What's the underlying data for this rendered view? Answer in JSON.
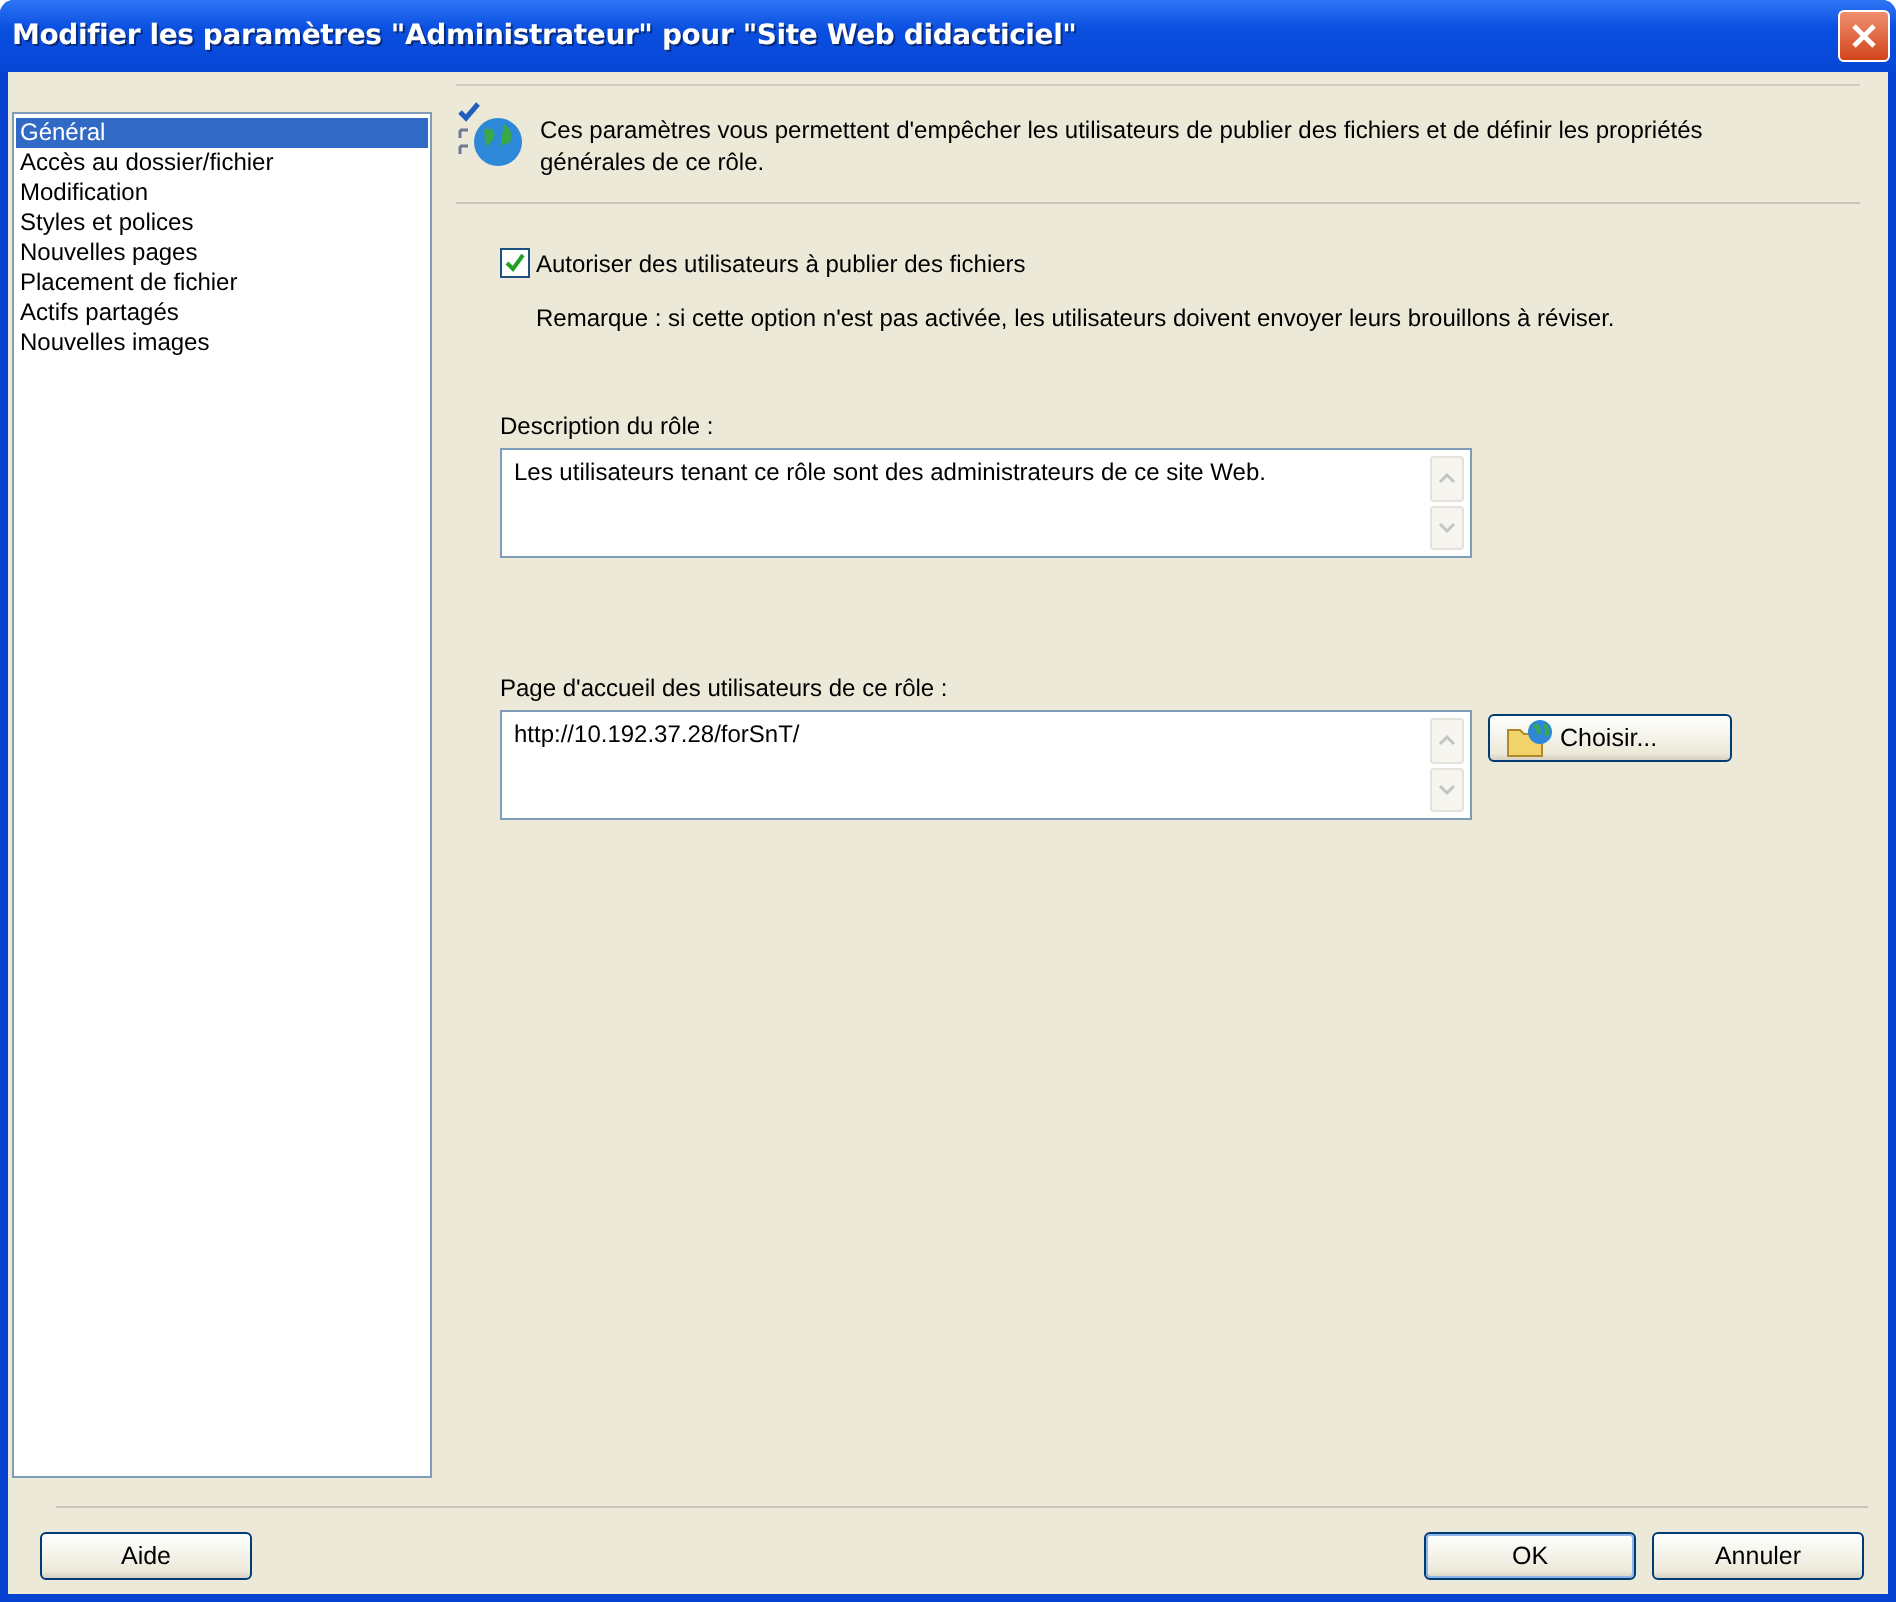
{
  "window": {
    "title": "Modifier les paramètres \"Administrateur\" pour \"Site Web didacticiel\""
  },
  "sidebar": {
    "items": [
      {
        "label": "Général",
        "selected": true
      },
      {
        "label": "Accès au dossier/fichier",
        "selected": false
      },
      {
        "label": "Modification",
        "selected": false
      },
      {
        "label": "Styles et polices",
        "selected": false
      },
      {
        "label": "Nouvelles pages",
        "selected": false
      },
      {
        "label": "Placement de fichier",
        "selected": false
      },
      {
        "label": "Actifs partagés",
        "selected": false
      },
      {
        "label": "Nouvelles images",
        "selected": false
      }
    ]
  },
  "header": {
    "text": "Ces paramètres vous permettent d'empêcher les utilisateurs de publier des fichiers et de définir les propriétés générales de ce rôle."
  },
  "publish": {
    "label": "Autoriser des utilisateurs à publier des fichiers",
    "checked": true,
    "note": "Remarque : si cette option n'est pas activée, les utilisateurs doivent envoyer leurs brouillons à réviser."
  },
  "description": {
    "label": "Description du rôle :",
    "value": "Les utilisateurs tenant ce rôle sont des administrateurs de ce site Web."
  },
  "homepage": {
    "label": "Page d'accueil des utilisateurs de ce rôle :",
    "value": "http://10.192.37.28/forSnT/",
    "button": "Choisir..."
  },
  "buttons": {
    "help": "Aide",
    "ok": "OK",
    "cancel": "Annuler"
  }
}
